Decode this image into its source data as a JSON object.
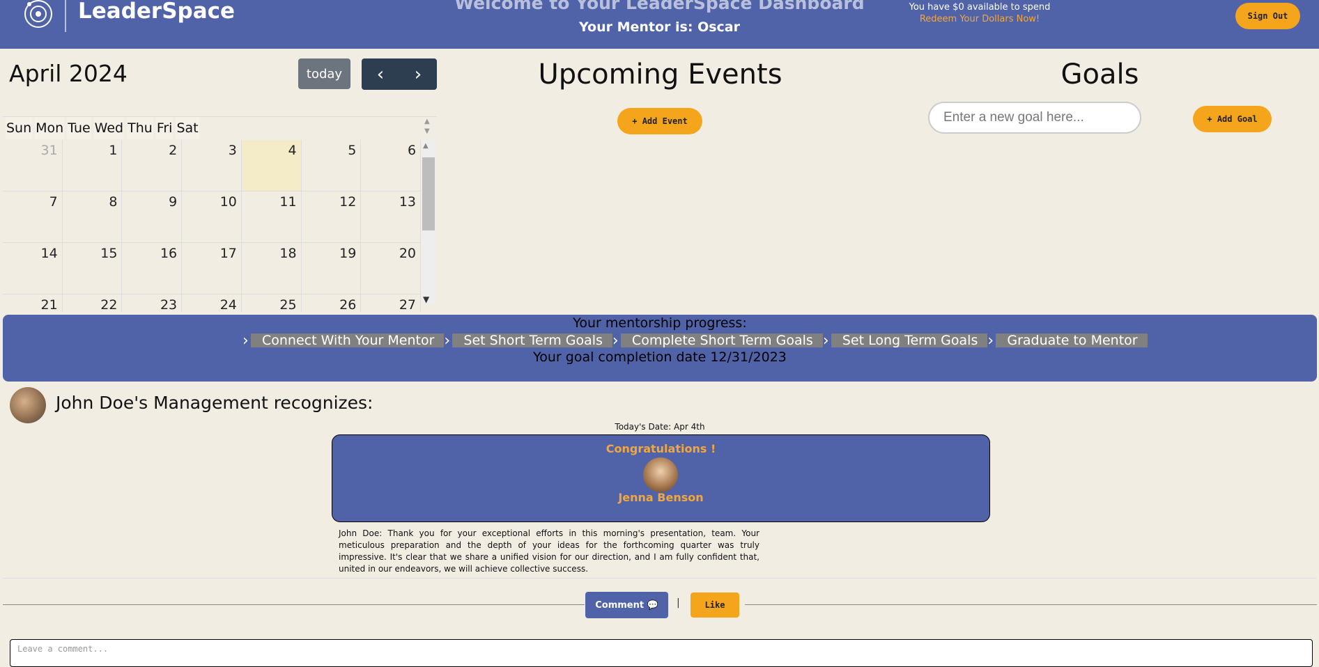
{
  "header": {
    "logo_text": "LeaderSpace",
    "welcome": "Welcome to Your LeaderSpace Dashboard",
    "mentor": "Your Mentor is: Oscar",
    "spend": "You have $0 available to spend",
    "redeem": "Redeem Your Dollars Now!",
    "sign_out": "Sign Out"
  },
  "calendar": {
    "title": "April 2024",
    "today_label": "today",
    "days_of_week": [
      "Sun",
      "Mon",
      "Tue",
      "Wed",
      "Thu",
      "Fri",
      "Sat"
    ],
    "weeks": [
      [
        "31",
        "1",
        "2",
        "3",
        "4",
        "5",
        "6"
      ],
      [
        "7",
        "8",
        "9",
        "10",
        "11",
        "12",
        "13"
      ],
      [
        "14",
        "15",
        "16",
        "17",
        "18",
        "19",
        "20"
      ],
      [
        "21",
        "22",
        "23",
        "24",
        "25",
        "26",
        "27"
      ]
    ],
    "today_date": "4"
  },
  "events": {
    "title": "Upcoming Events",
    "add_label": "+ Add Event"
  },
  "goals": {
    "title": "Goals",
    "placeholder": "Enter a new goal here...",
    "add_label": "+ Add Goal"
  },
  "progress": {
    "title": "Your mentorship progress:",
    "steps": [
      "Connect With Your Mentor",
      "Set Short Term Goals",
      "Complete Short Term Goals",
      "Set Long Term Goals",
      "Graduate to Mentor"
    ],
    "completion": "Your goal completion date 12/31/2023"
  },
  "recognition": {
    "title": "John Doe's Management recognizes:",
    "today": "Today's Date: Apr 4th",
    "congrats": "Congratulations !",
    "recipient": "Jenna Benson",
    "message": "John Doe: Thank you for your exceptional efforts in this morning's presentation, team. Your meticulous preparation and the depth of your ideas for the forthcoming quarter was truly impressive. It's clear that we share a unified vision for our direction, and I am fully confident that, united in our endeavors, we will achieve collective success.",
    "comment_label": "Comment 💬",
    "separator": "|",
    "like_label": "Like",
    "comment_placeholder": "Leave a comment..."
  },
  "colors": {
    "brand": "#5163a8",
    "accent": "#f5a51c",
    "panel": "#f2ede3"
  }
}
